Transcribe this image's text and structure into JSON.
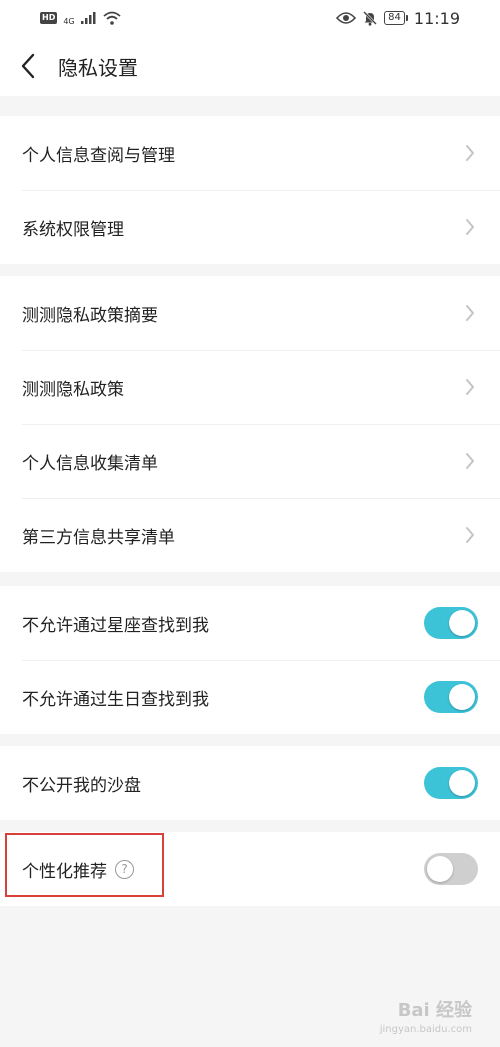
{
  "status_bar": {
    "badge": "HD",
    "network": "4G",
    "battery": "84",
    "time": "11:19"
  },
  "header": {
    "title": "隐私设置"
  },
  "groups": [
    {
      "items": [
        {
          "label": "个人信息查阅与管理"
        },
        {
          "label": "系统权限管理"
        }
      ]
    },
    {
      "items": [
        {
          "label": "测测隐私政策摘要"
        },
        {
          "label": "测测隐私政策"
        },
        {
          "label": "个人信息收集清单"
        },
        {
          "label": "第三方信息共享清单"
        }
      ]
    },
    {
      "items": [
        {
          "label": "不允许通过星座查找到我",
          "toggle": "on"
        },
        {
          "label": "不允许通过生日查找到我",
          "toggle": "on"
        }
      ]
    },
    {
      "items": [
        {
          "label": "不公开我的沙盘",
          "toggle": "on"
        }
      ]
    },
    {
      "items": [
        {
          "label": "个性化推荐",
          "help_icon": "question-icon",
          "toggle": "off"
        }
      ]
    }
  ],
  "colors": {
    "toggle_on": "#3cc3d8",
    "toggle_off": "#cfcfcf",
    "highlight": "#d9403a"
  },
  "watermark": {
    "text": "Bai 经验",
    "sub": "jingyan.baidu.com"
  }
}
